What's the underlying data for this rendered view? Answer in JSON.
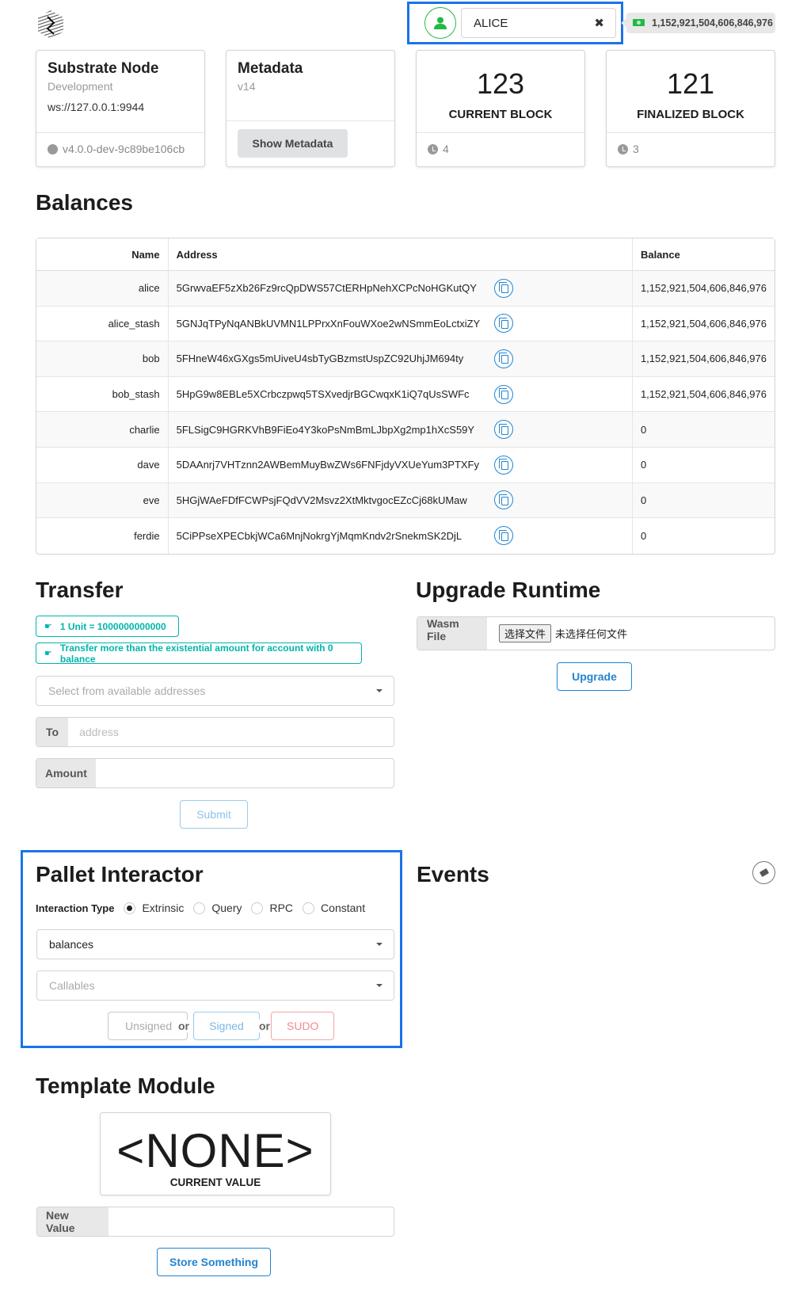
{
  "header": {
    "logo": "substrate-logo-icon",
    "account": {
      "avatar_icon": "user-icon",
      "selected": "ALICE",
      "clear_icon": "close-icon",
      "balance_icon": "money-bill-icon",
      "balance": "1,152,921,504,606,846,976"
    }
  },
  "cards": {
    "node": {
      "title": "Substrate Node",
      "meta": "Development",
      "endpoint": "ws://127.0.0.1:9944",
      "version_icon": "gear-icon",
      "version": "v4.0.0-dev-9c89be106cb"
    },
    "metadata": {
      "title": "Metadata",
      "meta": "v14",
      "button": "Show Metadata"
    },
    "current_block": {
      "value": "123",
      "label": "CURRENT BLOCK",
      "timer_icon": "clock-icon",
      "timer": "4"
    },
    "finalized_block": {
      "value": "121",
      "label": "FINALIZED BLOCK",
      "timer_icon": "clock-icon",
      "timer": "3"
    }
  },
  "balances": {
    "title": "Balances",
    "columns": [
      "Name",
      "Address",
      "Balance"
    ],
    "rows": [
      {
        "name": "alice",
        "address": "5GrwvaEF5zXb26Fz9rcQpDWS57CtERHpNehXCPcNoHGKutQY",
        "balance": "1,152,921,504,606,846,976"
      },
      {
        "name": "alice_stash",
        "address": "5GNJqTPyNqANBkUVMN1LPPrxXnFouWXoe2wNSmmEoLctxiZY",
        "balance": "1,152,921,504,606,846,976"
      },
      {
        "name": "bob",
        "address": "5FHneW46xGXgs5mUiveU4sbTyGBzmstUspZC92UhjJM694ty",
        "balance": "1,152,921,504,606,846,976"
      },
      {
        "name": "bob_stash",
        "address": "5HpG9w8EBLe5XCrbczpwq5TSXvedjrBGCwqxK1iQ7qUsSWFc",
        "balance": "1,152,921,504,606,846,976"
      },
      {
        "name": "charlie",
        "address": "5FLSigC9HGRKVhB9FiEo4Y3koPsNmBmLJbpXg2mp1hXcS59Y",
        "balance": "0"
      },
      {
        "name": "dave",
        "address": "5DAAnrj7VHTznn2AWBemMuyBwZWs6FNFjdyVXUeYum3PTXFy",
        "balance": "0"
      },
      {
        "name": "eve",
        "address": "5HGjWAeFDfFCWPsjFQdVV2Msvz2XtMktvgocEZcCj68kUMaw",
        "balance": "0"
      },
      {
        "name": "ferdie",
        "address": "5CiPPseXPECbkjWCa6MnjNokrgYjMqmKndv2rSnekmSK2DjL",
        "balance": "0"
      }
    ],
    "copy_icon": "copy-icon"
  },
  "transfer": {
    "title": "Transfer",
    "notes": [
      "1 Unit = 1000000000000",
      "Transfer more than the existential amount for account with 0 balance"
    ],
    "note_icon": "hand-point-right-icon",
    "from_placeholder": "Select from available addresses",
    "to_label": "To",
    "to_placeholder": "address",
    "to_value": "",
    "amount_label": "Amount",
    "amount_value": "",
    "submit": "Submit"
  },
  "upgrade": {
    "title": "Upgrade Runtime",
    "file_label": "Wasm File",
    "choose_button": "选择文件",
    "no_file": "未选择任何文件",
    "button": "Upgrade"
  },
  "pallet": {
    "title": "Pallet Interactor",
    "type_label": "Interaction Type",
    "types": [
      {
        "label": "Extrinsic",
        "selected": true
      },
      {
        "label": "Query",
        "selected": false
      },
      {
        "label": "RPC",
        "selected": false
      },
      {
        "label": "Constant",
        "selected": false
      }
    ],
    "pallet_value": "balances",
    "callables_placeholder": "Callables",
    "buttons": {
      "unsigned": "Unsigned",
      "or1": "or",
      "signed": "Signed",
      "or2": "or",
      "sudo": "SUDO"
    }
  },
  "events": {
    "title": "Events",
    "clear_icon": "eraser-icon"
  },
  "template": {
    "title": "Template Module",
    "value": "<NONE>",
    "value_label": "CURRENT VALUE",
    "new_value_label": "New Value",
    "new_value": "",
    "button": "Store Something"
  },
  "colors": {
    "accent_blue": "#2185d0",
    "highlight_blue": "#1a73e8",
    "teal": "#00b5ad",
    "green": "#21ba45",
    "sudo_red": "#f08c8c"
  }
}
